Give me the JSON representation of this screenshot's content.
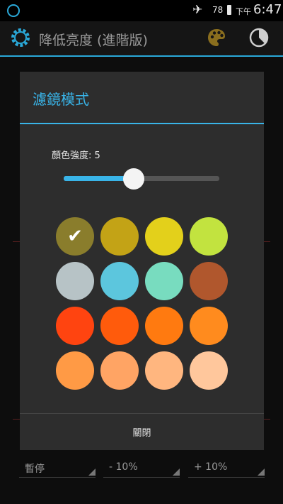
{
  "status_bar": {
    "battery_level": "78",
    "ampm": "下午",
    "time": "6:47"
  },
  "action_bar": {
    "title": "降低亮度 (進階版)"
  },
  "dialog": {
    "title": "濾鏡模式",
    "intensity_label": "顏色強度: 5",
    "intensity_fraction": 0.45,
    "swatches": [
      {
        "color": "#8a7d2c",
        "selected": true
      },
      {
        "color": "#c3a316",
        "selected": false
      },
      {
        "color": "#e3d01b",
        "selected": false
      },
      {
        "color": "#c2e33f",
        "selected": false
      },
      {
        "color": "#b7c3c6",
        "selected": false
      },
      {
        "color": "#5cc6dd",
        "selected": false
      },
      {
        "color": "#78dcbf",
        "selected": false
      },
      {
        "color": "#b0572d",
        "selected": false
      },
      {
        "color": "#ff4410",
        "selected": false
      },
      {
        "color": "#ff5b0c",
        "selected": false
      },
      {
        "color": "#ff7a10",
        "selected": false
      },
      {
        "color": "#ff8b1e",
        "selected": false
      },
      {
        "color": "#ff9a45",
        "selected": false
      },
      {
        "color": "#ffa464",
        "selected": false
      },
      {
        "color": "#ffb67f",
        "selected": false
      },
      {
        "color": "#ffc79c",
        "selected": false
      }
    ],
    "close_label": "關閉"
  },
  "bottom_bar": {
    "pause_label": "暫停",
    "minus_label": "- 10%",
    "plus_label": "+ 10%"
  },
  "colors": {
    "accent": "#39b4e8",
    "dialog_bg": "#2d2d2d"
  }
}
